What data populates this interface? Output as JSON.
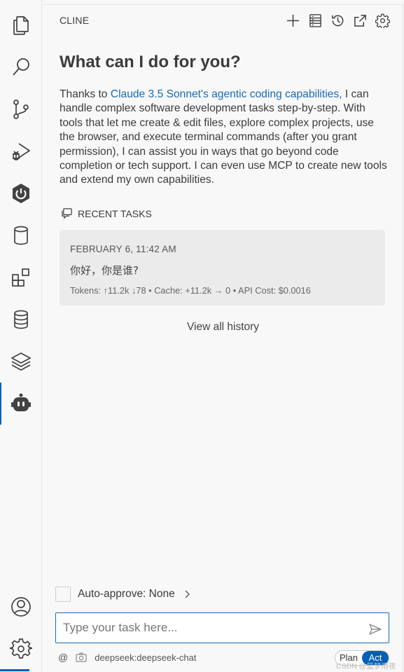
{
  "activity_bar": {
    "items": [
      {
        "name": "explorer",
        "icon": "files-icon"
      },
      {
        "name": "search",
        "icon": "search-icon"
      },
      {
        "name": "source-control",
        "icon": "source-control-icon"
      },
      {
        "name": "run-debug",
        "icon": "run-debug-icon"
      },
      {
        "name": "spring-boot",
        "icon": "power-icon"
      },
      {
        "name": "database",
        "icon": "database-icon"
      },
      {
        "name": "extensions",
        "icon": "extensions-icon"
      },
      {
        "name": "sql-tools",
        "icon": "stacked-database-icon"
      },
      {
        "name": "layers",
        "icon": "layers-icon"
      },
      {
        "name": "cline",
        "icon": "robot-icon",
        "active": true
      }
    ],
    "bottom": [
      {
        "name": "accounts",
        "icon": "account-icon"
      },
      {
        "name": "manage",
        "icon": "gear-icon"
      }
    ],
    "accent_color": "#005fb8"
  },
  "panel": {
    "title": "CLINE",
    "toolbar": [
      "plus-icon",
      "mcp-server-icon",
      "history-icon",
      "popout-icon",
      "gear-icon"
    ]
  },
  "welcome": {
    "heading": "What can I do for you?",
    "intro_before": "Thanks to ",
    "intro_link": "Claude 3.5 Sonnet's agentic coding capabilities,",
    "intro_after": " I can handle complex software development tasks step-by-step. With tools that let me create & edit files, explore complex projects, use the browser, and execute terminal commands (after you grant permission), I can assist you in ways that go beyond code completion or tech support. I can even use MCP to create new tools and extend my own capabilities."
  },
  "recent_tasks": {
    "title": "RECENT TASKS",
    "items": [
      {
        "date": "FEBRUARY 6, 11:42 AM",
        "text": "你好，你是谁?",
        "meta": "Tokens: ↑11.2k ↓78 • Cache: +11.2k → 0 • API Cost: $0.0016"
      }
    ],
    "view_all": "View all history"
  },
  "composer": {
    "auto_approve": "Auto-approve: None",
    "placeholder": "Type your task here...",
    "value": "",
    "at_symbol": "@",
    "model": "deepseek:deepseek-chat",
    "mode_plan": "Plan",
    "mode_act": "Act",
    "active_mode": "Act"
  },
  "watermark": "CSDN @蓝梦雨夜猫"
}
